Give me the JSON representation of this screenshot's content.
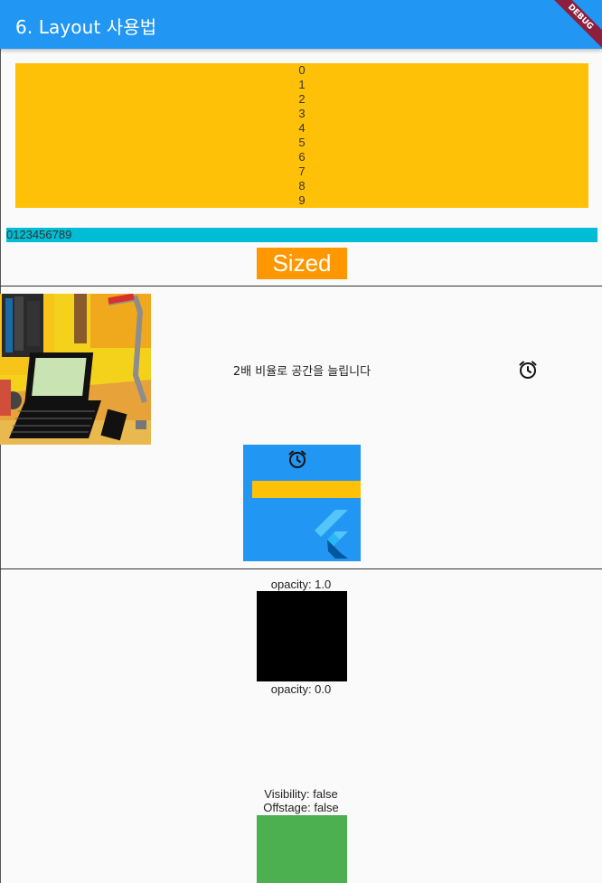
{
  "appbar": {
    "title": "6. Layout 사용법",
    "debug_banner": "DEBUG",
    "color": "#2196f3"
  },
  "column_list": {
    "items": [
      "0",
      "1",
      "2",
      "3",
      "4",
      "5",
      "6",
      "7",
      "8",
      "9"
    ],
    "color": "#ffc107"
  },
  "row_list": {
    "text": "0123456789",
    "color": "#00bcd4"
  },
  "sized_box": {
    "label": "Sized",
    "color": "#ff9800"
  },
  "expanded_row": {
    "text": "2배 비율로 공간을 늘립니다",
    "icon": "alarm-icon"
  },
  "stack": {
    "icon": "alarm-icon",
    "logo": "flutter-logo",
    "background": "#2196f3",
    "bar_color": "#ffc107"
  },
  "opacity_demo": {
    "visible_label": "opacity: 1.0",
    "hidden_label": "opacity: 0.0"
  },
  "visibility_demo": {
    "visibility_label": "Visibility: false",
    "offstage_label": "Offstage: false",
    "color": "#4caf50"
  }
}
